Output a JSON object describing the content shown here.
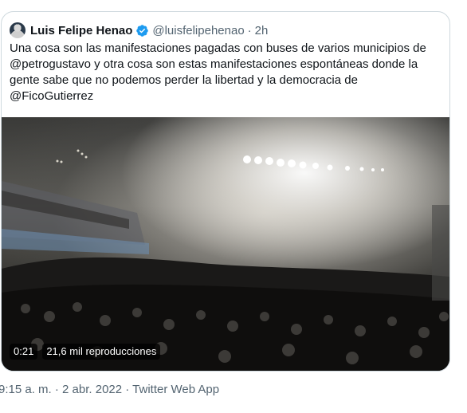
{
  "tweet": {
    "author_name": "Luis Felipe Henao",
    "handle": "@luisfelipehenao",
    "separator": "·",
    "time_ago": "2h",
    "text": "Una cosa son las manifestaciones pagadas con buses de varios municipios de\n@petrogustavo y otra cosa son estas manifestaciones espontáneas donde la\ngente sabe que no podemos perder la libertad y la democracia de\n@FicoGutierrez"
  },
  "video": {
    "duration": "0:21",
    "views": "21,6 mil reproducciones"
  },
  "footer": {
    "timestamp": "9:15 a. m. · 2 abr. 2022 · Twitter Web App"
  },
  "colors": {
    "verified": "#1d9bf0",
    "secondary_text": "#536471",
    "border": "#cfd9de"
  },
  "icons": [
    "verified-badge-icon",
    "avatar"
  ]
}
